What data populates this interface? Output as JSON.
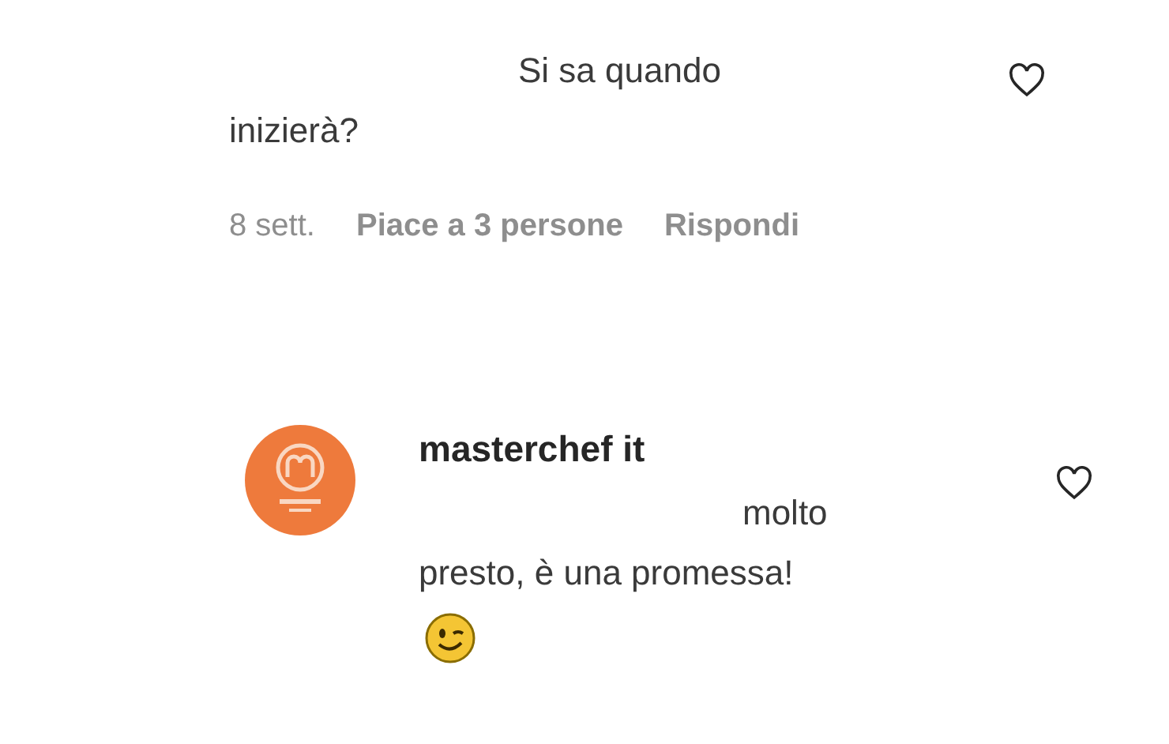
{
  "comments": [
    {
      "kind": "plain",
      "body": "Si sa quando inizierà?",
      "liked": false,
      "meta": {
        "time": "8 sett.",
        "likes": "Piace a 3 persone",
        "reply": "Rispondi"
      }
    },
    {
      "kind": "with-avatar",
      "username": "masterchef it",
      "body": "molto presto, è una promessa!",
      "liked": false,
      "emoji": true
    }
  ]
}
